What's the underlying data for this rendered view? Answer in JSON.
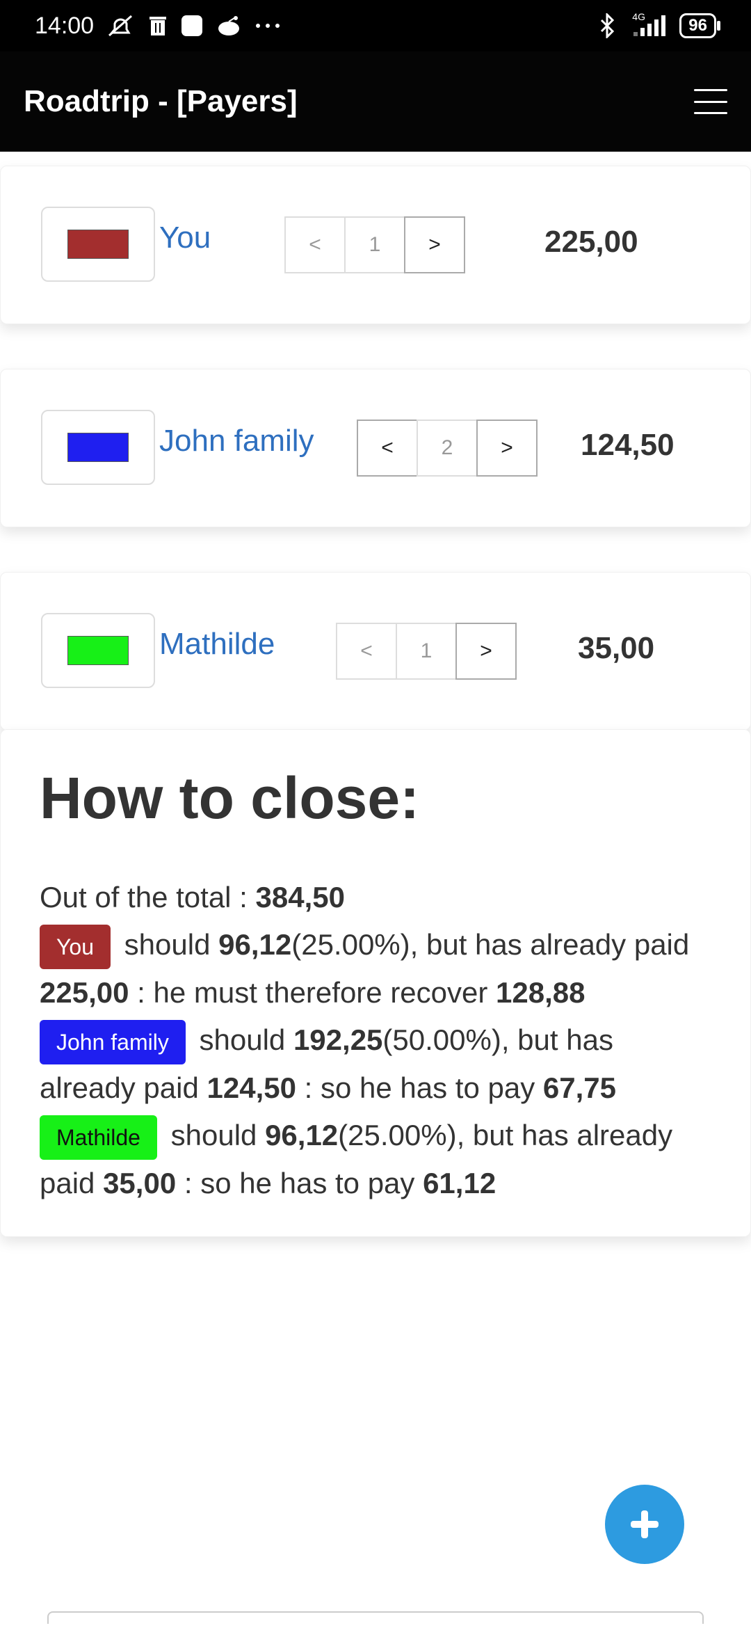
{
  "statusbar": {
    "time": "14:00",
    "icons_left": [
      "mute-icon",
      "trash-icon",
      "app-square-icon",
      "reddit-icon",
      "more-dots-icon"
    ],
    "icons_right": [
      "bluetooth-icon",
      "signal-4g-icon"
    ],
    "network": "4G",
    "battery": "96"
  },
  "appbar": {
    "title": "Roadtrip - [Payers]",
    "menu_icon": "hamburger-menu-icon"
  },
  "payers": [
    {
      "name": "You",
      "color": "#a32e2e",
      "step_prev": "<",
      "step_value": "1",
      "step_next": ">",
      "amount": "225,00"
    },
    {
      "name": "John family",
      "color": "#1f1ff0",
      "step_prev": "<",
      "step_value": "2",
      "step_next": ">",
      "amount": "124,50"
    },
    {
      "name": "Mathilde",
      "color": "#17f017",
      "step_prev": "<",
      "step_value": "1",
      "step_next": ">",
      "amount": "35,00"
    }
  ],
  "close": {
    "title": "How to close:",
    "total_label": "Out of the total : ",
    "total": "384,50",
    "should": " should ",
    "but_paid": ", but has already paid ",
    "lines": [
      {
        "name": "You",
        "should_amount": "96,12",
        "pct": "(25.00%)",
        "paid": "225,00",
        "action": " : he must therefore recover ",
        "result": "128,88"
      },
      {
        "name": "John family",
        "should_amount": "192,25",
        "pct": "(50.00%)",
        "paid": "124,50",
        "action": " : so he has to pay ",
        "result": "67,75"
      },
      {
        "name": "Mathilde",
        "should_amount": "96,12",
        "pct": "(25.00%)",
        "paid": "35,00",
        "action": " : so he has to pay ",
        "result": "61,12"
      }
    ]
  },
  "fab": {
    "icon": "plus-icon",
    "color": "#2d9be0"
  }
}
